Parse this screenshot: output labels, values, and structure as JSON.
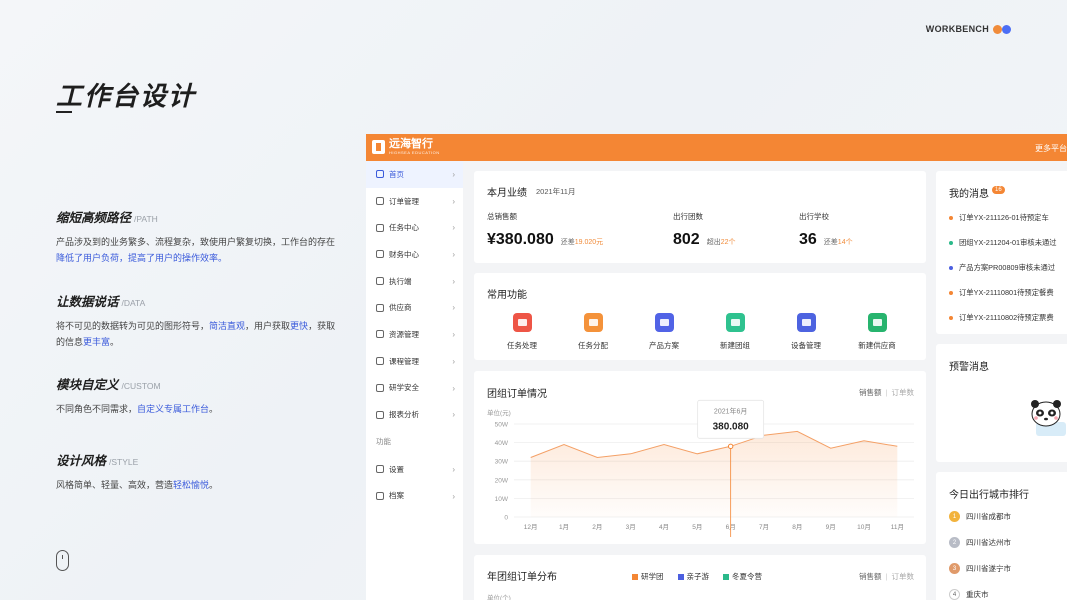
{
  "brand": {
    "name": "WORKBENCH"
  },
  "page": {
    "title": "工作台设计"
  },
  "features": [
    {
      "title": "缩短高频路径",
      "en": "/PATH",
      "line1": "产品涉及到的业务繁多、流程复杂，致使用户繁复切换，工作台的存在",
      "line2": "降低了用户负荷，提高了用户的操作效率。"
    },
    {
      "title": "让数据说话",
      "en": "/DATA",
      "line1a": "将不可见的数据转为可见的图形符号，",
      "line1b": "简洁直观",
      "line1c": "，用户获取",
      "line1d": "更快",
      "line1e": "，获取",
      "line2a": "的信息",
      "line2b": "更丰富",
      "line2c": "。"
    },
    {
      "title": "模块自定义",
      "en": "/CUSTOM",
      "line1a": "不同角色不同需求，",
      "line1b": "自定义专属工作台",
      "line1c": "。"
    },
    {
      "title": "设计风格",
      "en": "/STYLE",
      "line1a": "风格简单、轻量、高效，营造",
      "line1b": "轻松愉悦",
      "line1c": "。"
    }
  ],
  "app": {
    "logo_name": "远海智行",
    "logo_sub": "HIGHSEA EDUCATION",
    "more_platform": "更多平台",
    "sidebar": [
      {
        "label": "首页",
        "active": true
      },
      {
        "label": "订单管理"
      },
      {
        "label": "任务中心"
      },
      {
        "label": "财务中心"
      },
      {
        "label": "执行端"
      },
      {
        "label": "供应商"
      },
      {
        "label": "资源管理"
      },
      {
        "label": "课程管理"
      },
      {
        "label": "研学安全"
      },
      {
        "label": "报表分析"
      }
    ],
    "sidebar_section": "功能",
    "sidebar_extra": [
      {
        "label": "设置"
      },
      {
        "label": "档案"
      }
    ],
    "performance": {
      "title": "本月业绩",
      "date": "2021年11月",
      "metrics": [
        {
          "label": "总销售额",
          "value": "¥380.080",
          "note_prefix": "还差",
          "note_value": "19.020元"
        },
        {
          "label": "出行团数",
          "value": "802",
          "note_prefix": "超出",
          "note_value": "22个"
        },
        {
          "label": "出行学校",
          "value": "36",
          "note_prefix": "还差",
          "note_value": "14个"
        }
      ]
    },
    "common": {
      "title": "常用功能",
      "items": [
        {
          "label": "任务处理",
          "color": "#ee5546"
        },
        {
          "label": "任务分配",
          "color": "#f4923a"
        },
        {
          "label": "产品方案",
          "color": "#5163e6"
        },
        {
          "label": "新建团组",
          "color": "#2fc28f"
        },
        {
          "label": "设备管理",
          "color": "#4d63e0"
        },
        {
          "label": "新建供应商",
          "color": "#27b46e"
        }
      ]
    },
    "tour_chart": {
      "title": "团组订单情况",
      "tab_active": "销售额",
      "tab_other": "订单数",
      "unit": "单位(元)",
      "tooltip_date": "2021年6月",
      "tooltip_value": "380.080"
    },
    "distribution": {
      "title": "年团组订单分布",
      "unit": "单位(个)",
      "tab_active": "销售额",
      "tab_other": "订单数",
      "legend": [
        {
          "label": "研学团",
          "color": "#f48634"
        },
        {
          "label": "亲子游",
          "color": "#4c5fe0"
        },
        {
          "label": "冬夏令营",
          "color": "#2bb98a"
        }
      ]
    },
    "messages": {
      "title": "我的消息",
      "badge": "16",
      "items": [
        {
          "text": "订单YX-211126-01待预定车",
          "color": "#f48634"
        },
        {
          "text": "团组YX-211204-01审核未通过",
          "color": "#2bb98a"
        },
        {
          "text": "产品方案PR00809审核未通过",
          "color": "#4c5fe0"
        },
        {
          "text": "订单YX-21110801待预定餐费",
          "color": "#f48634"
        },
        {
          "text": "订单YX-21110802待预定票费",
          "color": "#f48634"
        }
      ]
    },
    "warnings": {
      "title": "预警消息"
    },
    "ranking": {
      "title": "今日出行城市排行",
      "items": [
        {
          "rank": "1",
          "city": "四川省成都市",
          "color": "#f2b33d"
        },
        {
          "rank": "2",
          "city": "四川省达州市",
          "color": "#b8bcc6"
        },
        {
          "rank": "3",
          "city": "四川省遂宁市",
          "color": "#e09a6a"
        },
        {
          "rank": "4",
          "city": "重庆市",
          "color": "#ffffff"
        }
      ]
    }
  },
  "chart_data": {
    "type": "area",
    "title": "团组订单情况",
    "ylabel": "单位(元)",
    "x": [
      "12月",
      "1月",
      "2月",
      "3月",
      "4月",
      "5月",
      "6月",
      "7月",
      "8月",
      "9月",
      "10月",
      "11月"
    ],
    "y_ticks": [
      "0",
      "10W",
      "20W",
      "30W",
      "40W",
      "50W"
    ],
    "ylim": [
      0,
      50
    ],
    "series": [
      {
        "values": [
          32,
          39,
          32,
          34,
          39,
          34,
          38,
          44,
          46,
          37,
          41,
          38
        ]
      }
    ],
    "highlight": {
      "x": "6月",
      "label": "2021年6月",
      "value": "380.080"
    }
  }
}
